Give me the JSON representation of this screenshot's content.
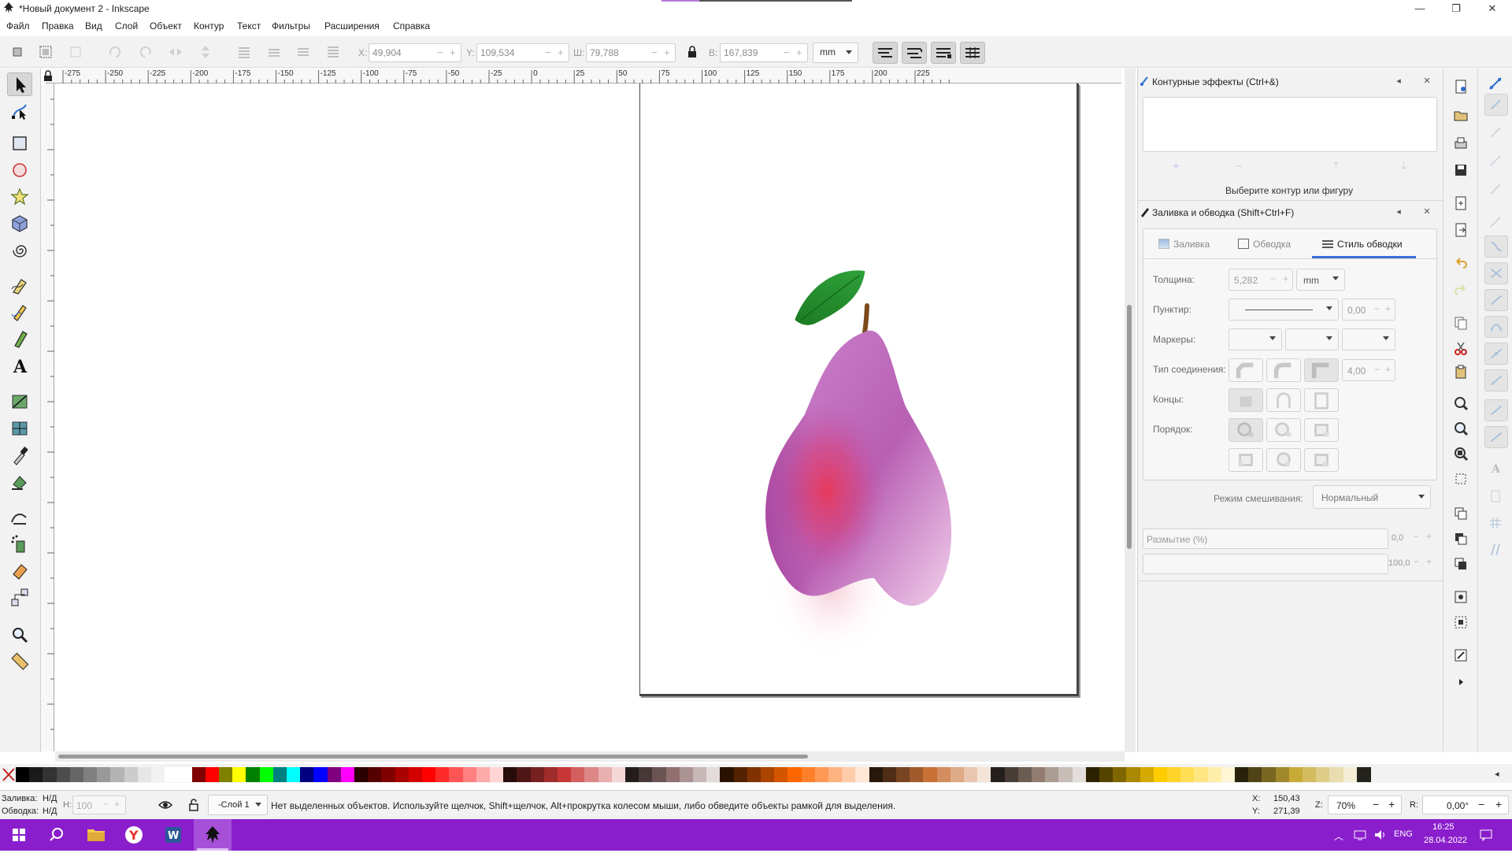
{
  "window": {
    "title": "*Новый документ 2 - Inkscape"
  },
  "menu": [
    "Файл",
    "Правка",
    "Вид",
    "Слой",
    "Объект",
    "Контур",
    "Текст",
    "Фильтры",
    "Расширения",
    "Справка"
  ],
  "controls": {
    "x_label": "X:",
    "x_value": "49,904",
    "y_label": "Y:",
    "y_value": "109,534",
    "w_label": "Ш:",
    "w_value": "79,788",
    "h_label": "В:",
    "h_value": "167,839",
    "unit": "mm"
  },
  "ruler_top": [
    "-275",
    "-250",
    "-225",
    "-200",
    "-175",
    "-150",
    "-125",
    "-100",
    "-75",
    "-50",
    "-25",
    "0",
    "25",
    "50",
    "75",
    "100",
    "125",
    "150",
    "175",
    "200",
    "225"
  ],
  "path_effects": {
    "title": "Контурные эффекты (Ctrl+&)",
    "hint": "Выберите контур или фигуру"
  },
  "fill_stroke": {
    "title": "Заливка и обводка (Shift+Ctrl+F)",
    "tabs": [
      "Заливка",
      "Обводка",
      "Стиль обводки"
    ],
    "active_tab": "Стиль обводки",
    "width_label": "Толщина:",
    "width_value": "5,282",
    "width_unit": "mm",
    "dash_label": "Пунктир:",
    "dash_offset": "0,00",
    "markers_label": "Маркеры:",
    "join_label": "Тип соединения:",
    "miter_value": "4,00",
    "cap_label": "Концы:",
    "order_label": "Порядок:",
    "blend_label": "Режим смешивания:",
    "blend_value": "Нормальный",
    "blur_label": "Размытие (%)",
    "blur_value": "0,0",
    "opacity_value": "100,0"
  },
  "status": {
    "fill_label": "Заливка:",
    "fill_value": "Н/Д",
    "stroke_label": "Обводка:",
    "stroke_value": "Н/Д",
    "h_label": "Н:",
    "h_value": "100",
    "layer": "-Слой 1",
    "message": "Нет выделенных объектов. Используйте щелчок, Shift+щелчок, Alt+прокрутка колесом мыши, либо обведите объекты рамкой для выделения.",
    "x_label": "X:",
    "x_value": "150,43",
    "y_label": "Y:",
    "y_value": "271,39",
    "zoom_label": "Z:",
    "zoom_value": "70%",
    "rotate_label": "R:",
    "rotate_value": "0,00°"
  },
  "taskbar": {
    "lang": "ENG",
    "time": "16:25",
    "date": "28.04.2022"
  },
  "colors": {
    "taskbar": "#8a1ecc",
    "accent_tab": "#3a6fd8",
    "pear_top": "#c98ac8",
    "pear_blush": "#e23a5c",
    "leaf": "#1e8a2c"
  }
}
